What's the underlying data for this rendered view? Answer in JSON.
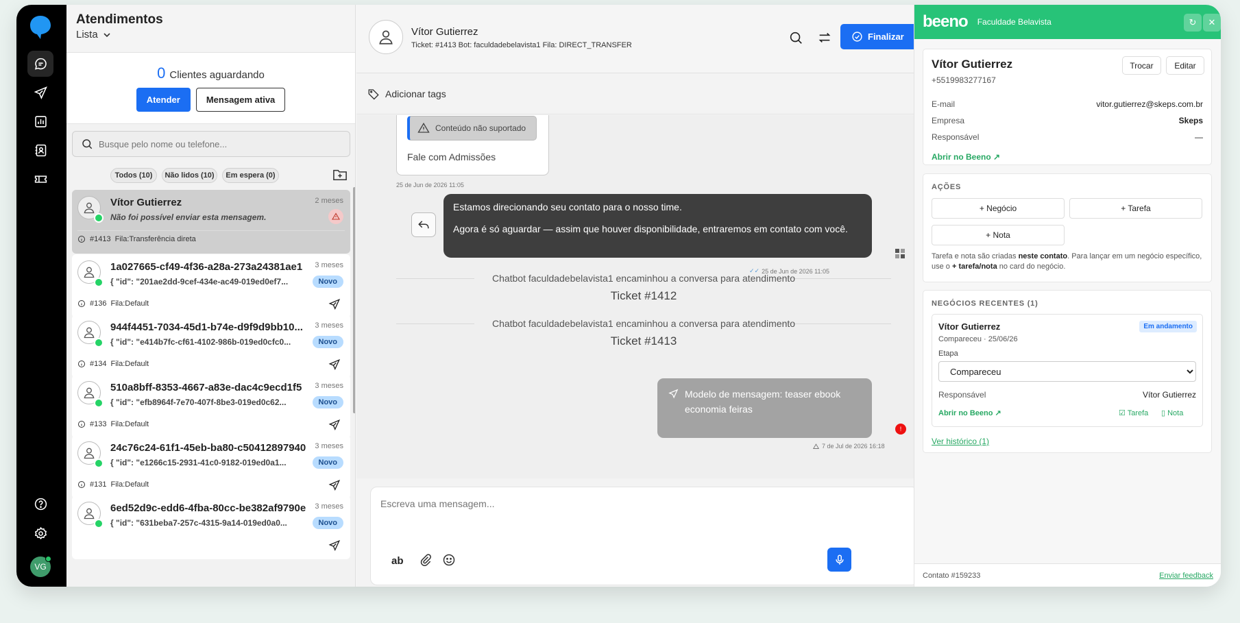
{
  "sidebar": {
    "avatar_initials": "VG"
  },
  "list": {
    "title": "Atendimentos",
    "view": "Lista",
    "waiting_count": "0",
    "waiting_label": "Clientes aguardando",
    "attend_button": "Atender",
    "active_message_button": "Mensagem ativa",
    "search_placeholder": "Busque pelo nome ou telefone...",
    "filters": [
      "Todos (10)",
      "Não lidos (10)",
      "Em espera (0)"
    ],
    "items": [
      {
        "name": "Vítor Gutierrez",
        "msg": "Não foi possível enviar esta mensagem.",
        "time": "2 meses",
        "ticket": "#1413",
        "queue": "Fila:Transferência direta",
        "badge": ""
      },
      {
        "name": "1a027665-cf49-4f36-a28a-273a24381ae1",
        "msg": "{ \"id\": \"201ae2dd-9cef-434e-ac49-019ed0ef7...",
        "time": "3 meses",
        "ticket": "#136",
        "queue": "Fila:Default",
        "badge": "Novo"
      },
      {
        "name": "944f4451-7034-45d1-b74e-d9f9d9bb10...",
        "msg": "{ \"id\": \"e414b7fc-cf61-4102-986b-019ed0cfc0...",
        "time": "3 meses",
        "ticket": "#134",
        "queue": "Fila:Default",
        "badge": "Novo"
      },
      {
        "name": "510a8bff-8353-4667-a83e-dac4c9ecd1f5",
        "msg": "{ \"id\": \"efb8964f-7e70-407f-8be3-019ed0c62...",
        "time": "3 meses",
        "ticket": "#133",
        "queue": "Fila:Default",
        "badge": "Novo"
      },
      {
        "name": "24c76c24-61f1-45eb-ba80-c50412897940",
        "msg": "{ \"id\": \"e1266c15-2931-41c0-9182-019ed0a1...",
        "time": "3 meses",
        "ticket": "#131",
        "queue": "Fila:Default",
        "badge": "Novo"
      },
      {
        "name": "6ed52d9c-edd6-4fba-80cc-be382af9790e",
        "msg": "{ \"id\": \"631beba7-257c-4315-9a14-019ed0a0...",
        "time": "3 meses",
        "ticket": "",
        "queue": "",
        "badge": "Novo"
      }
    ]
  },
  "chat": {
    "contact_name": "Vítor Gutierrez",
    "meta": "Ticket: #1413  Bot: faculdadebelavista1  Fila: DIRECT_TRANSFER",
    "finalize_button": "Finalizar",
    "add_tags": "Adicionar tags",
    "unsupported": "Conteúdo não suportado",
    "fale": "Fale com Admissões",
    "ts1": "25 de Jun de 2026 11:05",
    "dark_line1": "Estamos direcionando seu contato para o nosso time.",
    "dark_line2": "Agora é só aguardar — assim que houver disponibilidade, entraremos em contato com você.",
    "ts2": "25 de Jun de 2026 11:05",
    "sys1": "Chatbot faculdadebelavista1 encaminhou a conversa para atendimento",
    "ticket1": "Ticket #1412",
    "sys2": "Chatbot faculdadebelavista1 encaminhou a conversa para atendimento",
    "ticket2": "Ticket #1413",
    "template_msg": "Modelo de mensagem: teaser ebook economia feiras",
    "ts3": "7 de Jul de 2026 16:18",
    "error_mark": "!",
    "compose_placeholder": "Escreva uma mensagem...",
    "format_label": "ab"
  },
  "panel": {
    "logo": "beeno",
    "org": "Faculdade Belavista",
    "contact": {
      "name": "Vítor Gutierrez",
      "phone": "+5519983277167",
      "swap_button": "Trocar",
      "edit_button": "Editar",
      "email_label": "E-mail",
      "email": "vitor.gutierrez@skeps.com.br",
      "company_label": "Empresa",
      "company": "Skeps",
      "owner_label": "Responsável",
      "owner": "—",
      "open_link": "Abrir no Beeno ↗"
    },
    "actions": {
      "title": "AÇÕES",
      "deal": "+ Negócio",
      "task": "+ Tarefa",
      "note": "+ Nota",
      "help_a": "Tarefa e nota são criadas ",
      "help_b": "neste contato",
      "help_c": ". Para lançar em um negócio específico, use o ",
      "help_d": "+ tarefa/nota",
      "help_e": " no card do negócio."
    },
    "deals": {
      "title": "NEGÓCIOS RECENTES (1)",
      "name": "Vítor Gutierrez",
      "status": "Em andamento",
      "sub": "Compareceu · 25/06/26",
      "stage_label": "Etapa",
      "stage": "Compareceu",
      "owner_label": "Responsável",
      "owner": "Vítor Gutierrez",
      "open_link": "Abrir no Beeno ↗",
      "task_link": "Tarefa",
      "note_link": "Nota",
      "history_link": "Ver histórico (1)"
    },
    "footer": {
      "contact_id": "Contato #159233",
      "feedback": "Enviar feedback"
    }
  }
}
